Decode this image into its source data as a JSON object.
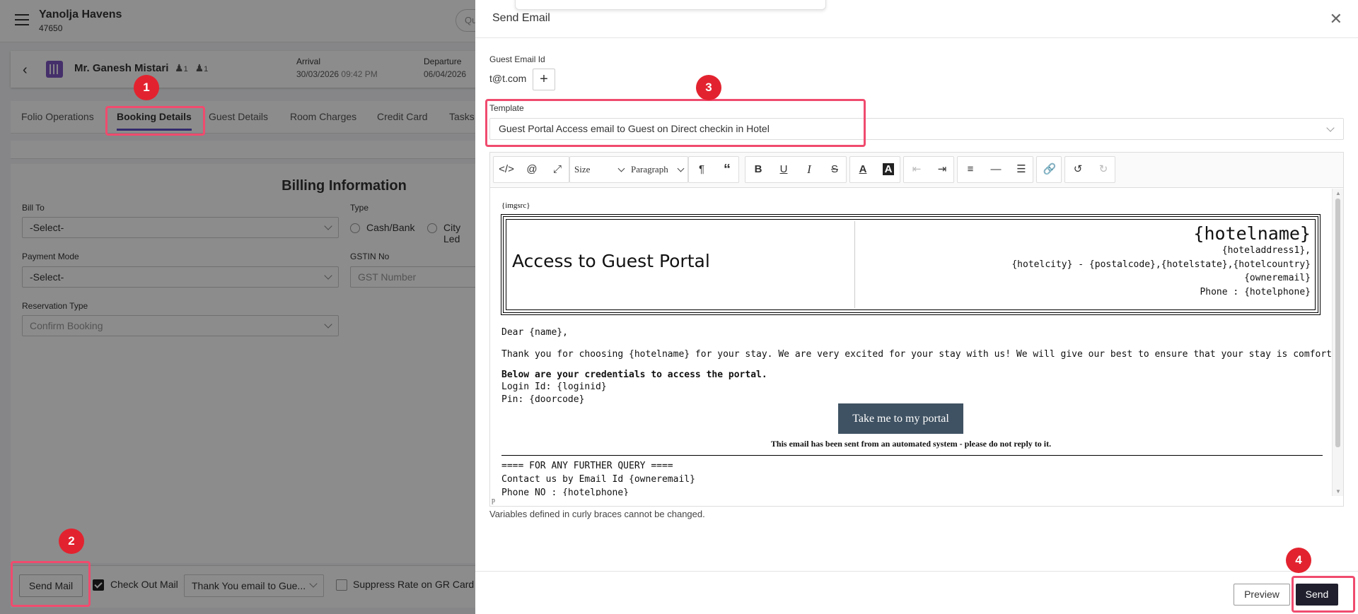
{
  "app": {
    "hotel_name": "Yanolja Havens",
    "hotel_code": "47650",
    "search_placeholder": "Qu"
  },
  "guest": {
    "name": "Mr. Ganesh Mistari",
    "adults": "1",
    "children": "1",
    "arrival_label": "Arrival",
    "arrival_date": "30/03/2026",
    "arrival_time": "09:42 PM",
    "departure_label": "Departure",
    "departure_date": "06/04/2026"
  },
  "tabs": [
    {
      "label": "Folio Operations"
    },
    {
      "label": "Booking Details",
      "active": true
    },
    {
      "label": "Guest Details"
    },
    {
      "label": "Room Charges"
    },
    {
      "label": "Credit Card"
    },
    {
      "label": "Tasks"
    }
  ],
  "billing": {
    "title": "Billing Information",
    "bill_to_label": "Bill To",
    "bill_to_value": "-Select-",
    "type_label": "Type",
    "type_options": [
      "Cash/Bank",
      "City Led"
    ],
    "payment_mode_label": "Payment Mode",
    "payment_mode_value": "-Select-",
    "gstin_label": "GSTIN No",
    "gstin_placeholder": "GST Number",
    "reservation_type_label": "Reservation Type",
    "reservation_type_value": "Confirm Booking"
  },
  "bottom_bar": {
    "send_mail": "Send Mail",
    "checkout_mail_label": "Check Out Mail",
    "checkout_mail_checked": true,
    "mail_template": "Thank You email to Gue...",
    "suppress_rate_label": "Suppress Rate on GR Card"
  },
  "modal": {
    "title": "Send Email",
    "guest_email_label": "Guest Email Id",
    "guest_email": "t@t.com",
    "add_icon": "plus-icon",
    "template_label": "Template",
    "template_value": "Guest Portal Access email to Guest on Direct checkin in Hotel",
    "toolbar": {
      "size_label": "Size",
      "paragraph_label": "Paragraph"
    },
    "content": {
      "imgsrc": "{imgsrc}",
      "portal_title": "Access to Guest Portal",
      "hotel_lines": [
        "{hotelname}",
        "{hoteladdress1},",
        "{hotelcity} - {postalcode},{hotelstate},{hotelcountry}",
        "{owneremail}",
        "Phone : {hotelphone}"
      ],
      "greeting": "Dear {name},",
      "thanks": "Thank you for choosing {hotelname} for your stay. We are very excited for your stay with us! We will give our best to ensure that your stay is comfortable and pleasant.",
      "credentials_heading": "Below are your credentials to access the portal.",
      "login_line": "Login Id: {loginid}",
      "pin_line": "Pin: {doorcode}",
      "portal_button": "Take me to my portal",
      "auto_note": "This email has been sent from an automated system - please do not reply to it.",
      "query_heading": "==== FOR ANY FURTHER QUERY ====",
      "contact_line": "Contact us by Email Id {owneremail}",
      "phone_line": "Phone NO : {hotelphone}",
      "status_tag": "p"
    },
    "variables_note": "Variables defined in curly braces cannot be changed.",
    "preview_label": "Preview",
    "send_label": "Send"
  },
  "annotations": {
    "markers": [
      "1",
      "2",
      "3",
      "4"
    ],
    "color": "#e2232f",
    "highlight_color": "#f04b6e"
  },
  "colors": {
    "accent": "#5c4dc7",
    "send_button": "#1f1f2e",
    "portal_button": "#3f5263"
  }
}
